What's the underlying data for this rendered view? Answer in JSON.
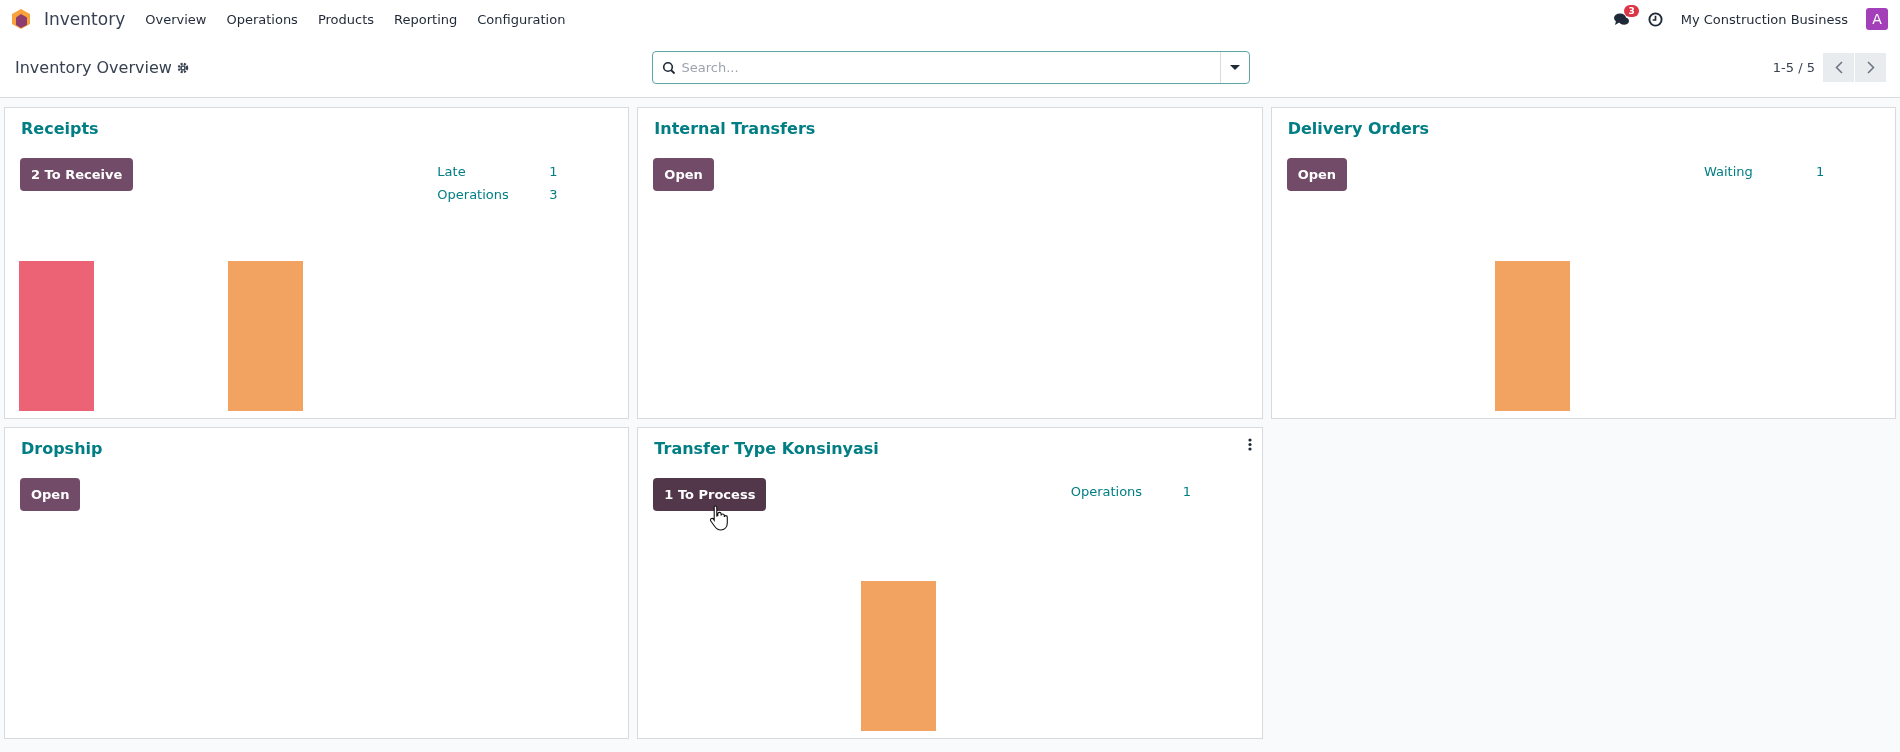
{
  "navbar": {
    "app_name": "Inventory",
    "menu": [
      "Overview",
      "Operations",
      "Products",
      "Reporting",
      "Configuration"
    ],
    "messages_badge": "3",
    "company": "My Construction Business",
    "avatar_letter": "A"
  },
  "control_panel": {
    "title": "Inventory Overview",
    "search": {
      "placeholder": "Search..."
    },
    "pager": "1-5 / 5"
  },
  "cards": [
    {
      "title": "Receipts",
      "button": {
        "label": "2 To Receive",
        "hovered": false
      },
      "menu": false,
      "stats": [
        {
          "label": "Late",
          "value": "1"
        },
        {
          "label": "Operations",
          "value": "3"
        }
      ],
      "graph": [
        {
          "kind": "bar",
          "color": "#ec6376"
        },
        {
          "kind": "bar",
          "color": "#f2a261"
        }
      ]
    },
    {
      "title": "Internal Transfers",
      "button": {
        "label": "Open",
        "hovered": false
      },
      "menu": false
    },
    {
      "title": "Delivery Orders",
      "button": {
        "label": "Open",
        "hovered": false
      },
      "menu": false,
      "stats": [
        {
          "label": "Waiting",
          "value": "1"
        }
      ],
      "graph": [
        {
          "kind": "gap"
        },
        {
          "kind": "bar",
          "color": "#f2a261"
        }
      ]
    },
    {
      "title": "Dropship",
      "button": {
        "label": "Open",
        "hovered": false
      },
      "menu": false
    },
    {
      "title": "Transfer Type Konsinyasi",
      "button": {
        "label": "1 To Process",
        "hovered": true
      },
      "menu": true,
      "stats": [
        {
          "label": "Operations",
          "value": "1"
        }
      ],
      "graph": [
        {
          "kind": "gap"
        },
        {
          "kind": "bar",
          "color": "#f2a261"
        }
      ]
    }
  ]
}
